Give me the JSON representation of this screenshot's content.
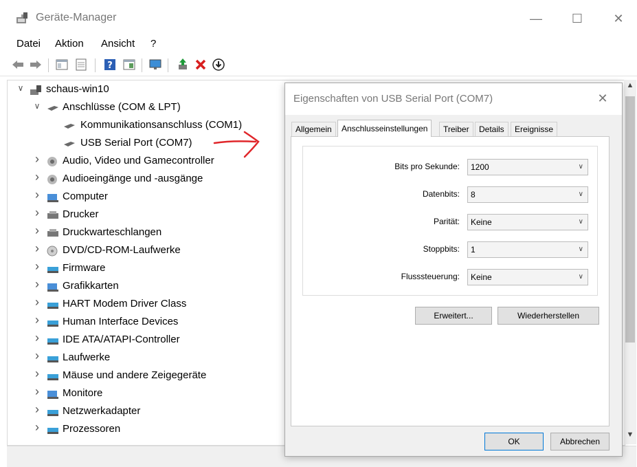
{
  "window": {
    "title": "Geräte-Manager",
    "minimize": "—",
    "maximize": "☐",
    "close": "✕"
  },
  "menu": [
    "Datei",
    "Aktion",
    "Ansicht",
    "?"
  ],
  "tree": {
    "root": "schaus-win10",
    "items": [
      {
        "label": "Anschlüsse (COM & LPT)",
        "expanded": true
      },
      {
        "label": "Kommunikationsanschluss (COM1)",
        "child": true
      },
      {
        "label": "USB Serial Port (COM7)",
        "child": true
      },
      {
        "label": "Audio, Video und Gamecontroller"
      },
      {
        "label": "Audioeingänge und -ausgänge"
      },
      {
        "label": "Computer"
      },
      {
        "label": "Drucker"
      },
      {
        "label": "Druckwarteschlangen"
      },
      {
        "label": "DVD/CD-ROM-Laufwerke"
      },
      {
        "label": "Firmware"
      },
      {
        "label": "Grafikkarten"
      },
      {
        "label": "HART Modem Driver Class"
      },
      {
        "label": "Human Interface Devices"
      },
      {
        "label": "IDE ATA/ATAPI-Controller"
      },
      {
        "label": "Laufwerke"
      },
      {
        "label": "Mäuse und andere Zeigegeräte"
      },
      {
        "label": "Monitore"
      },
      {
        "label": "Netzwerkadapter"
      },
      {
        "label": "Prozessoren"
      }
    ]
  },
  "dialog": {
    "title": "Eigenschaften von USB Serial Port (COM7)",
    "close": "✕",
    "tabs": [
      "Allgemein",
      "Anschlusseinstellungen",
      "Treiber",
      "Details",
      "Ereignisse"
    ],
    "active_tab": "Anschlusseinstellungen",
    "fields": [
      {
        "label": "Bits pro Sekunde:",
        "value": "1200"
      },
      {
        "label": "Datenbits:",
        "value": "8"
      },
      {
        "label": "Parität:",
        "value": "Keine"
      },
      {
        "label": "Stoppbits:",
        "value": "1"
      },
      {
        "label": "Flusssteuerung:",
        "value": "Keine"
      }
    ],
    "buttons": {
      "advanced": "Erweitert...",
      "restore": "Wiederherstellen",
      "ok": "OK",
      "cancel": "Abbrechen"
    }
  },
  "colors": {
    "annotation_arrow": "#e0262a",
    "accent": "#0078d7"
  }
}
